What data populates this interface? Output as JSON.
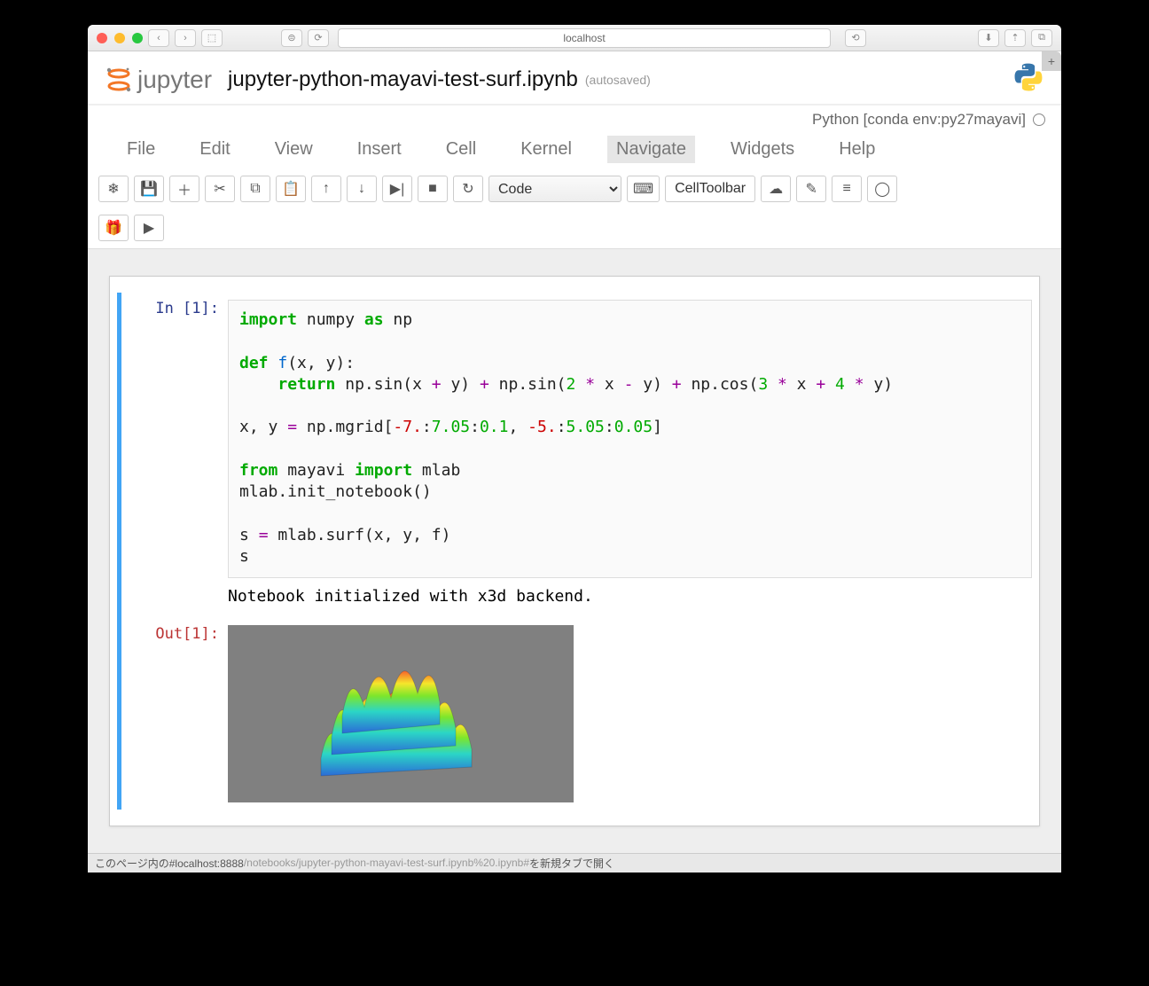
{
  "browser": {
    "url": "localhost",
    "buttons": {
      "back": "‹",
      "fwd": "›",
      "sidebar": "⬚",
      "reload": "⟳",
      "share": "⇡",
      "dl": "⬇",
      "tabs": "⧉",
      "plus": "+"
    }
  },
  "header": {
    "logo_text": "jupyter",
    "title": "jupyter-python-mayavi-test-surf.ipynb",
    "autosaved": "(autosaved)"
  },
  "kernel": {
    "name": "Python [conda env:py27mayavi]"
  },
  "menu": [
    "File",
    "Edit",
    "View",
    "Insert",
    "Cell",
    "Kernel",
    "Navigate",
    "Widgets",
    "Help"
  ],
  "menu_active": "Navigate",
  "toolbar": {
    "cell_type": "Code",
    "cell_toolbar_label": "CellToolbar",
    "icons": [
      "snowflake",
      "save",
      "plus",
      "cut",
      "copy",
      "paste",
      "up",
      "down",
      "run",
      "stop",
      "restart",
      "keyboard",
      "cloud",
      "brush",
      "list",
      "github",
      "gift",
      "youtube"
    ]
  },
  "cell": {
    "in_prompt": "In [1]:",
    "out_prompt": "Out[1]:",
    "code_plain": "import numpy as np\n\ndef f(x, y):\n    return np.sin(x + y) + np.sin(2 * x - y) + np.cos(3 * x + 4 * y)\n\nx, y = np.mgrid[-7.:7.05:0.1, -5.:5.05:0.05]\n\nfrom mayavi import mlab\nmlab.init_notebook()\n\ns = mlab.surf(x, y, f)\ns",
    "text_output": "Notebook initialized with x3d backend."
  },
  "status": {
    "prefix": "このページ内の#localhost:8888",
    "path": "/notebooks/jupyter-python-mayavi-test-surf.ipynb%20.ipynb#",
    "suffix": "を新規タブで開く"
  }
}
